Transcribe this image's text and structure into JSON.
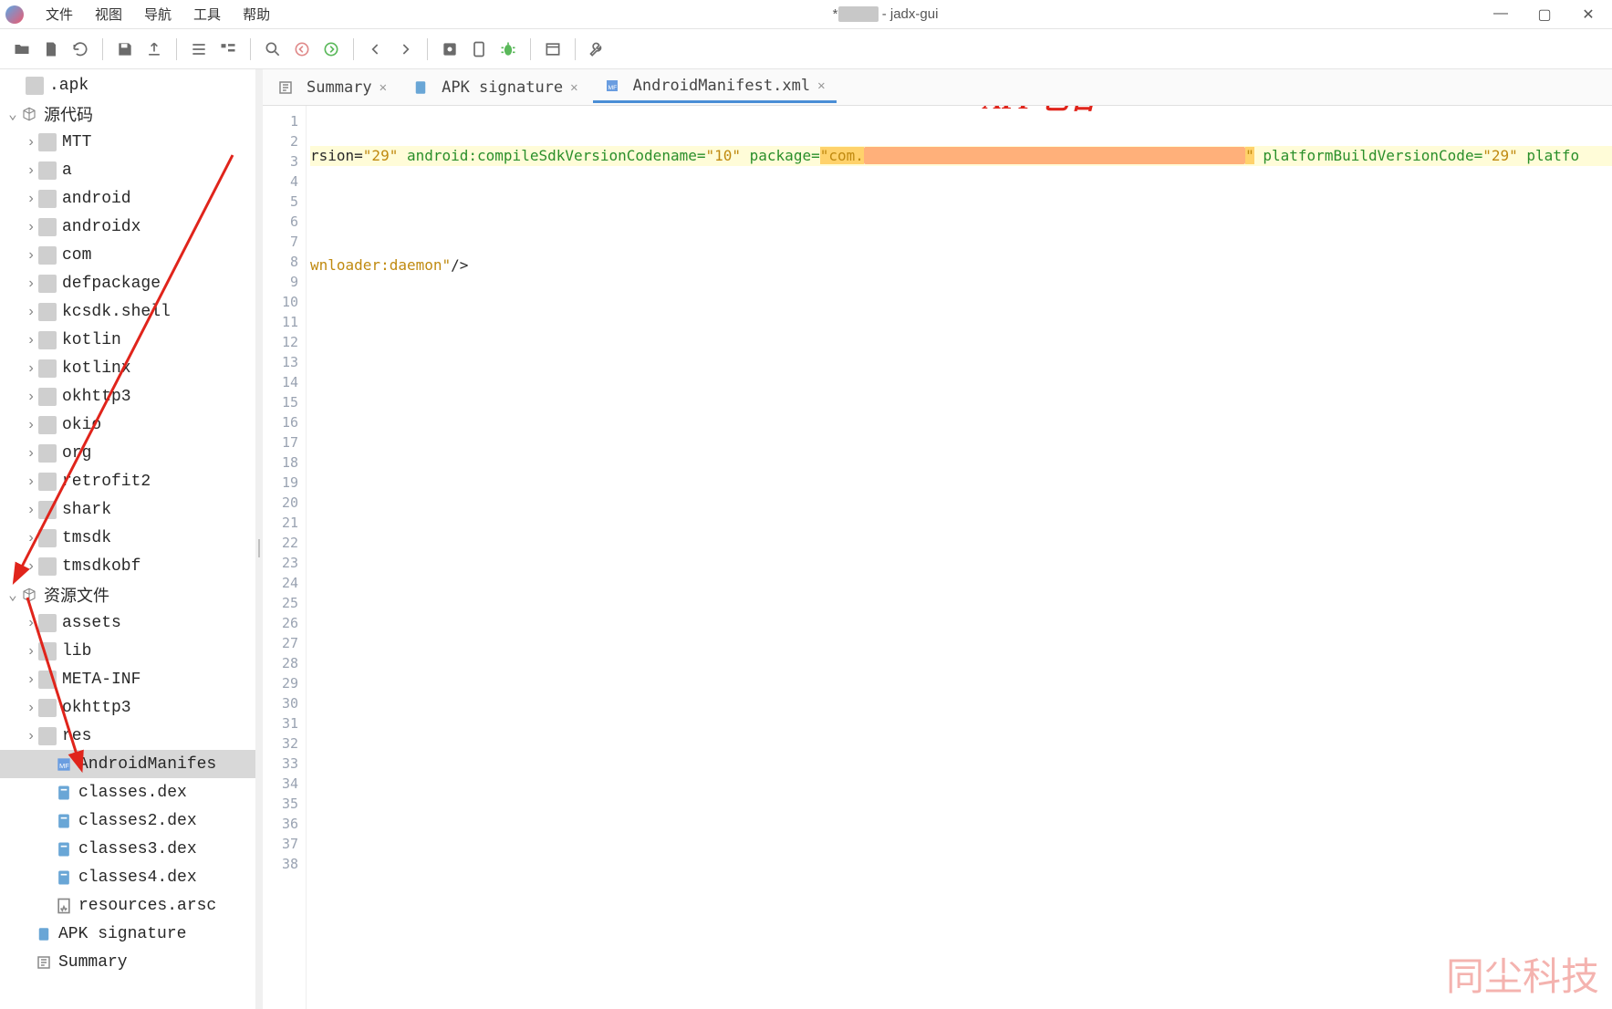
{
  "window": {
    "title_prefix": "*",
    "title_redacted": "XXXX",
    "title_suffix": " - jadx-gui"
  },
  "menu": {
    "items": [
      "文件",
      "视图",
      "导航",
      "工具",
      "帮助"
    ]
  },
  "toolbar": {
    "buttons": [
      "open",
      "new",
      "refresh",
      "sep",
      "save",
      "export",
      "sep",
      "flatten",
      "folder-tree",
      "sep",
      "search",
      "back",
      "forward",
      "sep",
      "goto",
      "sep",
      "settings-box",
      "preview",
      "bug",
      "sep",
      "panel",
      "sep",
      "wrench"
    ]
  },
  "tree": {
    "top_truncated": ".apk",
    "source_root": "源代码",
    "source_packages": [
      "MTT",
      "a",
      "android",
      "androidx",
      "com",
      "defpackage",
      "kcsdk.shell",
      "kotlin",
      "kotlinx",
      "okhttp3",
      "okio",
      "org",
      "retrofit2",
      "shark",
      "tmsdk",
      "tmsdkobf"
    ],
    "resource_root": "资源文件",
    "resource_dirs": [
      "assets",
      "lib",
      "META-INF",
      "okhttp3",
      "res"
    ],
    "resource_files": [
      "AndroidManifest.xml",
      "classes.dex",
      "classes2.dex",
      "classes3.dex",
      "classes4.dex",
      "resources.arsc"
    ],
    "apk_sig": "APK signature",
    "summary": "Summary"
  },
  "tabs": [
    {
      "label": "Summary",
      "icon": "sum",
      "active": false
    },
    {
      "label": "APK signature",
      "icon": "apk",
      "active": false
    },
    {
      "label": "AndroidManifest.xml",
      "icon": "mf",
      "active": true
    }
  ],
  "code": {
    "line1_pre": "rsion=",
    "line1_v1": "\"29\"",
    "line1_mid1": " android:compileSdkVersionCodename=",
    "line1_v2": "\"10\"",
    "line1_mid2": " package=",
    "line1_pkgpre": "\"com.",
    "line1_pkg_redacted": "xxxxxxxxxxxxxxxxxxxxxxxxxxxxxxxxxxxxxxxxxxx",
    "line1_pkgpost": "\"",
    "line1_mid3": " platformBuildVersionCode=",
    "line1_v3": "\"29\"",
    "line1_tail": " platfo",
    "line3_pre": "wnloader:daemon\"",
    "line3_tail": "/>",
    "max_line": 38
  },
  "annotations": {
    "pkg_label": "APP 包名",
    "watermark": "同尘科技"
  }
}
